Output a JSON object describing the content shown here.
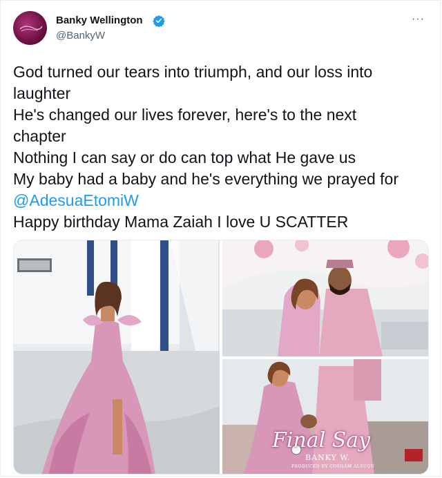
{
  "author": {
    "name": "Banky Wellington",
    "handle": "@BankyW",
    "verified": true,
    "avatar_icon": "profile-avatar"
  },
  "menu": {
    "more_icon": "more-options-icon",
    "more_glyph": "···"
  },
  "tweet": {
    "lines": [
      "God turned our tears into triumph, and our loss into",
      "laughter",
      "He's changed our lives forever, here's to the next",
      "chapter",
      "Nothing I can say or do can top what He gave us",
      "My baby had a baby and he's everything we prayed for"
    ],
    "mention": "@AdesuaEtomiW",
    "closing_line": "Happy birthday Mama Zaiah I love U SCATTER"
  },
  "media": {
    "photos": [
      "pregnant woman in pink ruffled gown",
      "couple embracing outdoors",
      "couple cover art"
    ],
    "cover_title": "Final Say",
    "cover_artist": "BANKY W.",
    "cover_producer": "PRODUCED BY COSHAM ALSUQU"
  },
  "colors": {
    "accent": "#1d9bf0",
    "text": "#0f1419",
    "secondary": "#536471",
    "gown_pink": "#d896b8"
  }
}
